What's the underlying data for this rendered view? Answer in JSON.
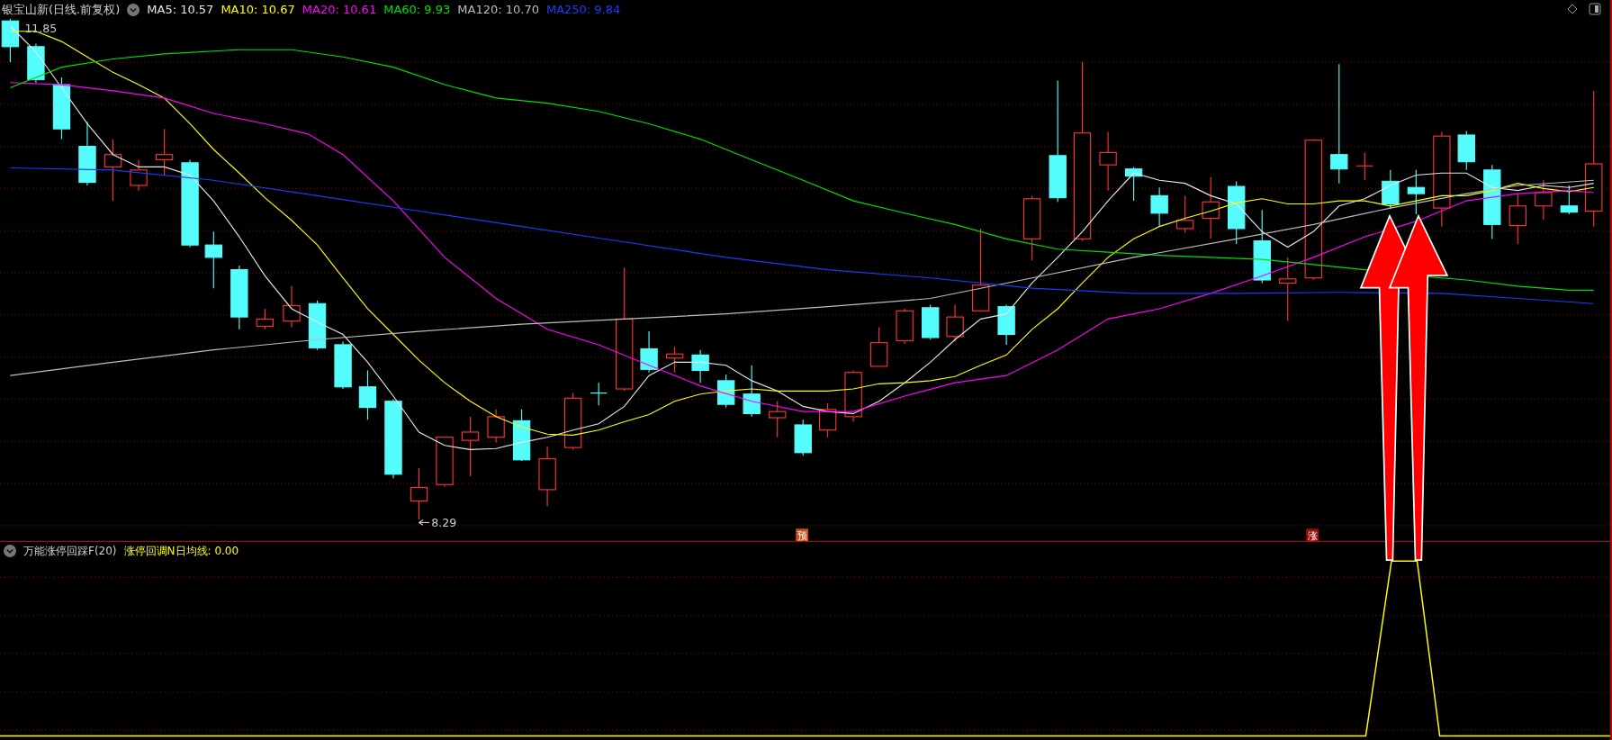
{
  "header": {
    "title": "银宝山新(日线.前复权)",
    "ma_labels": [
      {
        "text": "MA5: 10.57",
        "color": "#e6e6e6"
      },
      {
        "text": "MA10: 10.67",
        "color": "#ffff00"
      },
      {
        "text": "MA20: 10.61",
        "color": "#ff00ff"
      },
      {
        "text": "MA60: 9.93",
        "color": "#00e000"
      },
      {
        "text": "MA120: 10.70",
        "color": "#bdbdbd"
      },
      {
        "text": "MA250: 9.84",
        "color": "#1a3cff"
      }
    ]
  },
  "main_chart": {
    "max_label": "11.85",
    "min_label": "8.29",
    "markers": [
      {
        "text": "预",
        "color": "#c8521e"
      },
      {
        "text": "涨",
        "color": "#9a1010"
      }
    ]
  },
  "indicator": {
    "name": "万能涨停回踩F(20)",
    "line_label": "涨停回调N日均线: 0.00"
  }
}
